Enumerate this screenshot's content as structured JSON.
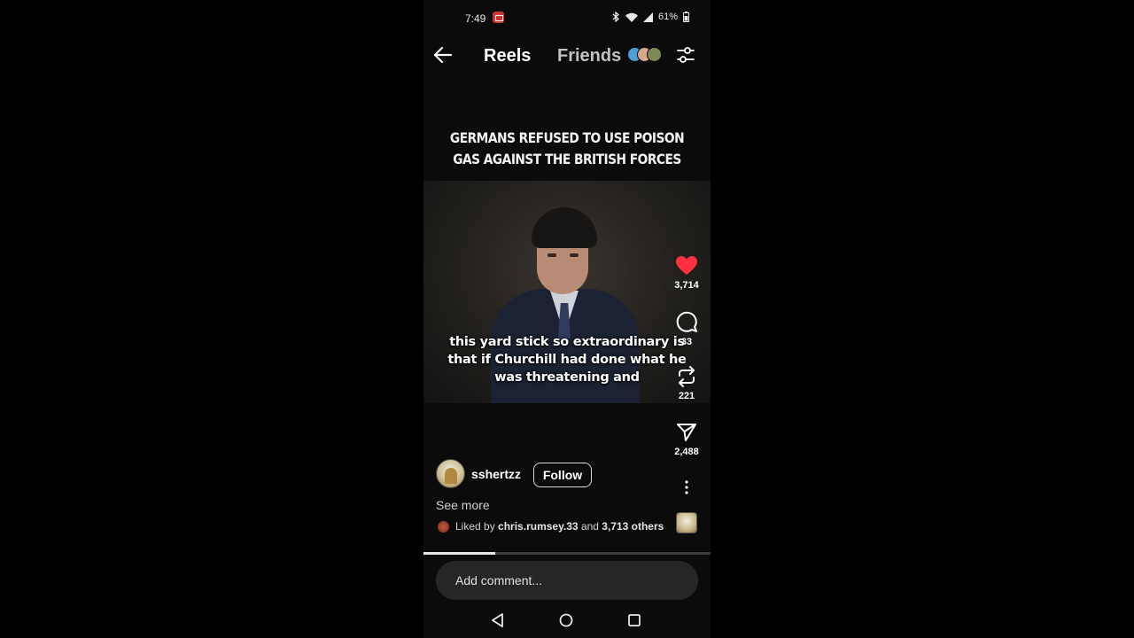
{
  "status_bar": {
    "time": "7:49",
    "battery": "61%"
  },
  "header": {
    "back_icon": "arrow-left-icon",
    "tabs": [
      {
        "label": "Reels",
        "active": true
      },
      {
        "label": "Friends",
        "active": false
      }
    ],
    "filter_icon": "sliders-icon"
  },
  "reel": {
    "caption_lines": [
      "GERMANS REFUSED TO USE POISON",
      "GAS AGAINST THE BRITISH FORCES"
    ],
    "subtitle_lines": [
      "this yard stick so extraordinary is",
      "that if Churchill had done what he",
      "was threatening and"
    ],
    "progress": 0.25
  },
  "actions": {
    "like_count": "3,714",
    "comment_count": "33",
    "repost_count": "221",
    "share_count": "2,488"
  },
  "author": {
    "username": "sshertzz",
    "follow_label": "Follow",
    "see_more_label": "See more"
  },
  "liked_by": {
    "prefix": "Liked by",
    "user": "chris.rumsey.33",
    "joiner": "and",
    "others": "3,713 others"
  },
  "comment": {
    "placeholder": "Add comment..."
  },
  "colors": {
    "like_heart": "#ff3040",
    "background": "#0b0b0b",
    "comment_box": "#262626"
  }
}
